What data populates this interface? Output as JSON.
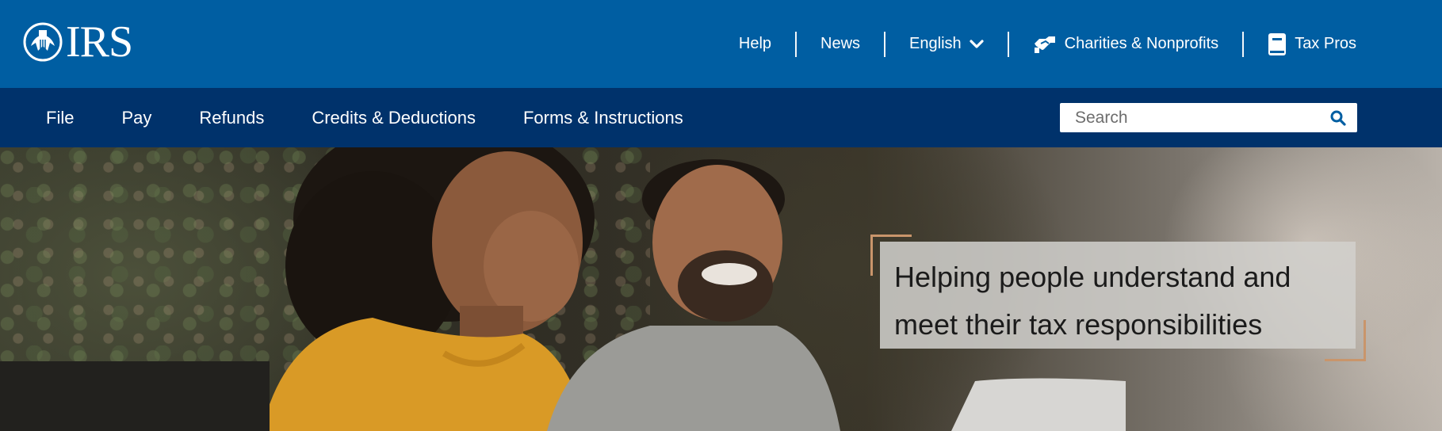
{
  "brand": {
    "logo_text": "IRS",
    "logo_icon": "irs-eagle-icon"
  },
  "utility_nav": [
    {
      "label": "Help"
    },
    {
      "label": "News"
    },
    {
      "label": "English",
      "icon": "chevron-down-icon"
    },
    {
      "label": "Charities & Nonprofits",
      "icon": "handshake-icon"
    },
    {
      "label": "Tax Pros",
      "icon": "book-icon"
    }
  ],
  "main_nav": [
    {
      "label": "File"
    },
    {
      "label": "Pay"
    },
    {
      "label": "Refunds"
    },
    {
      "label": "Credits & Deductions"
    },
    {
      "label": "Forms & Instructions"
    }
  ],
  "search": {
    "placeholder": "Search",
    "icon": "search-icon"
  },
  "hero": {
    "tagline_line1": "Helping people understand and",
    "tagline_line2": "meet their tax responsibilities"
  },
  "colors": {
    "top_bar": "#005ea2",
    "main_bar": "#00326b",
    "accent_frame": "#c9956b"
  }
}
